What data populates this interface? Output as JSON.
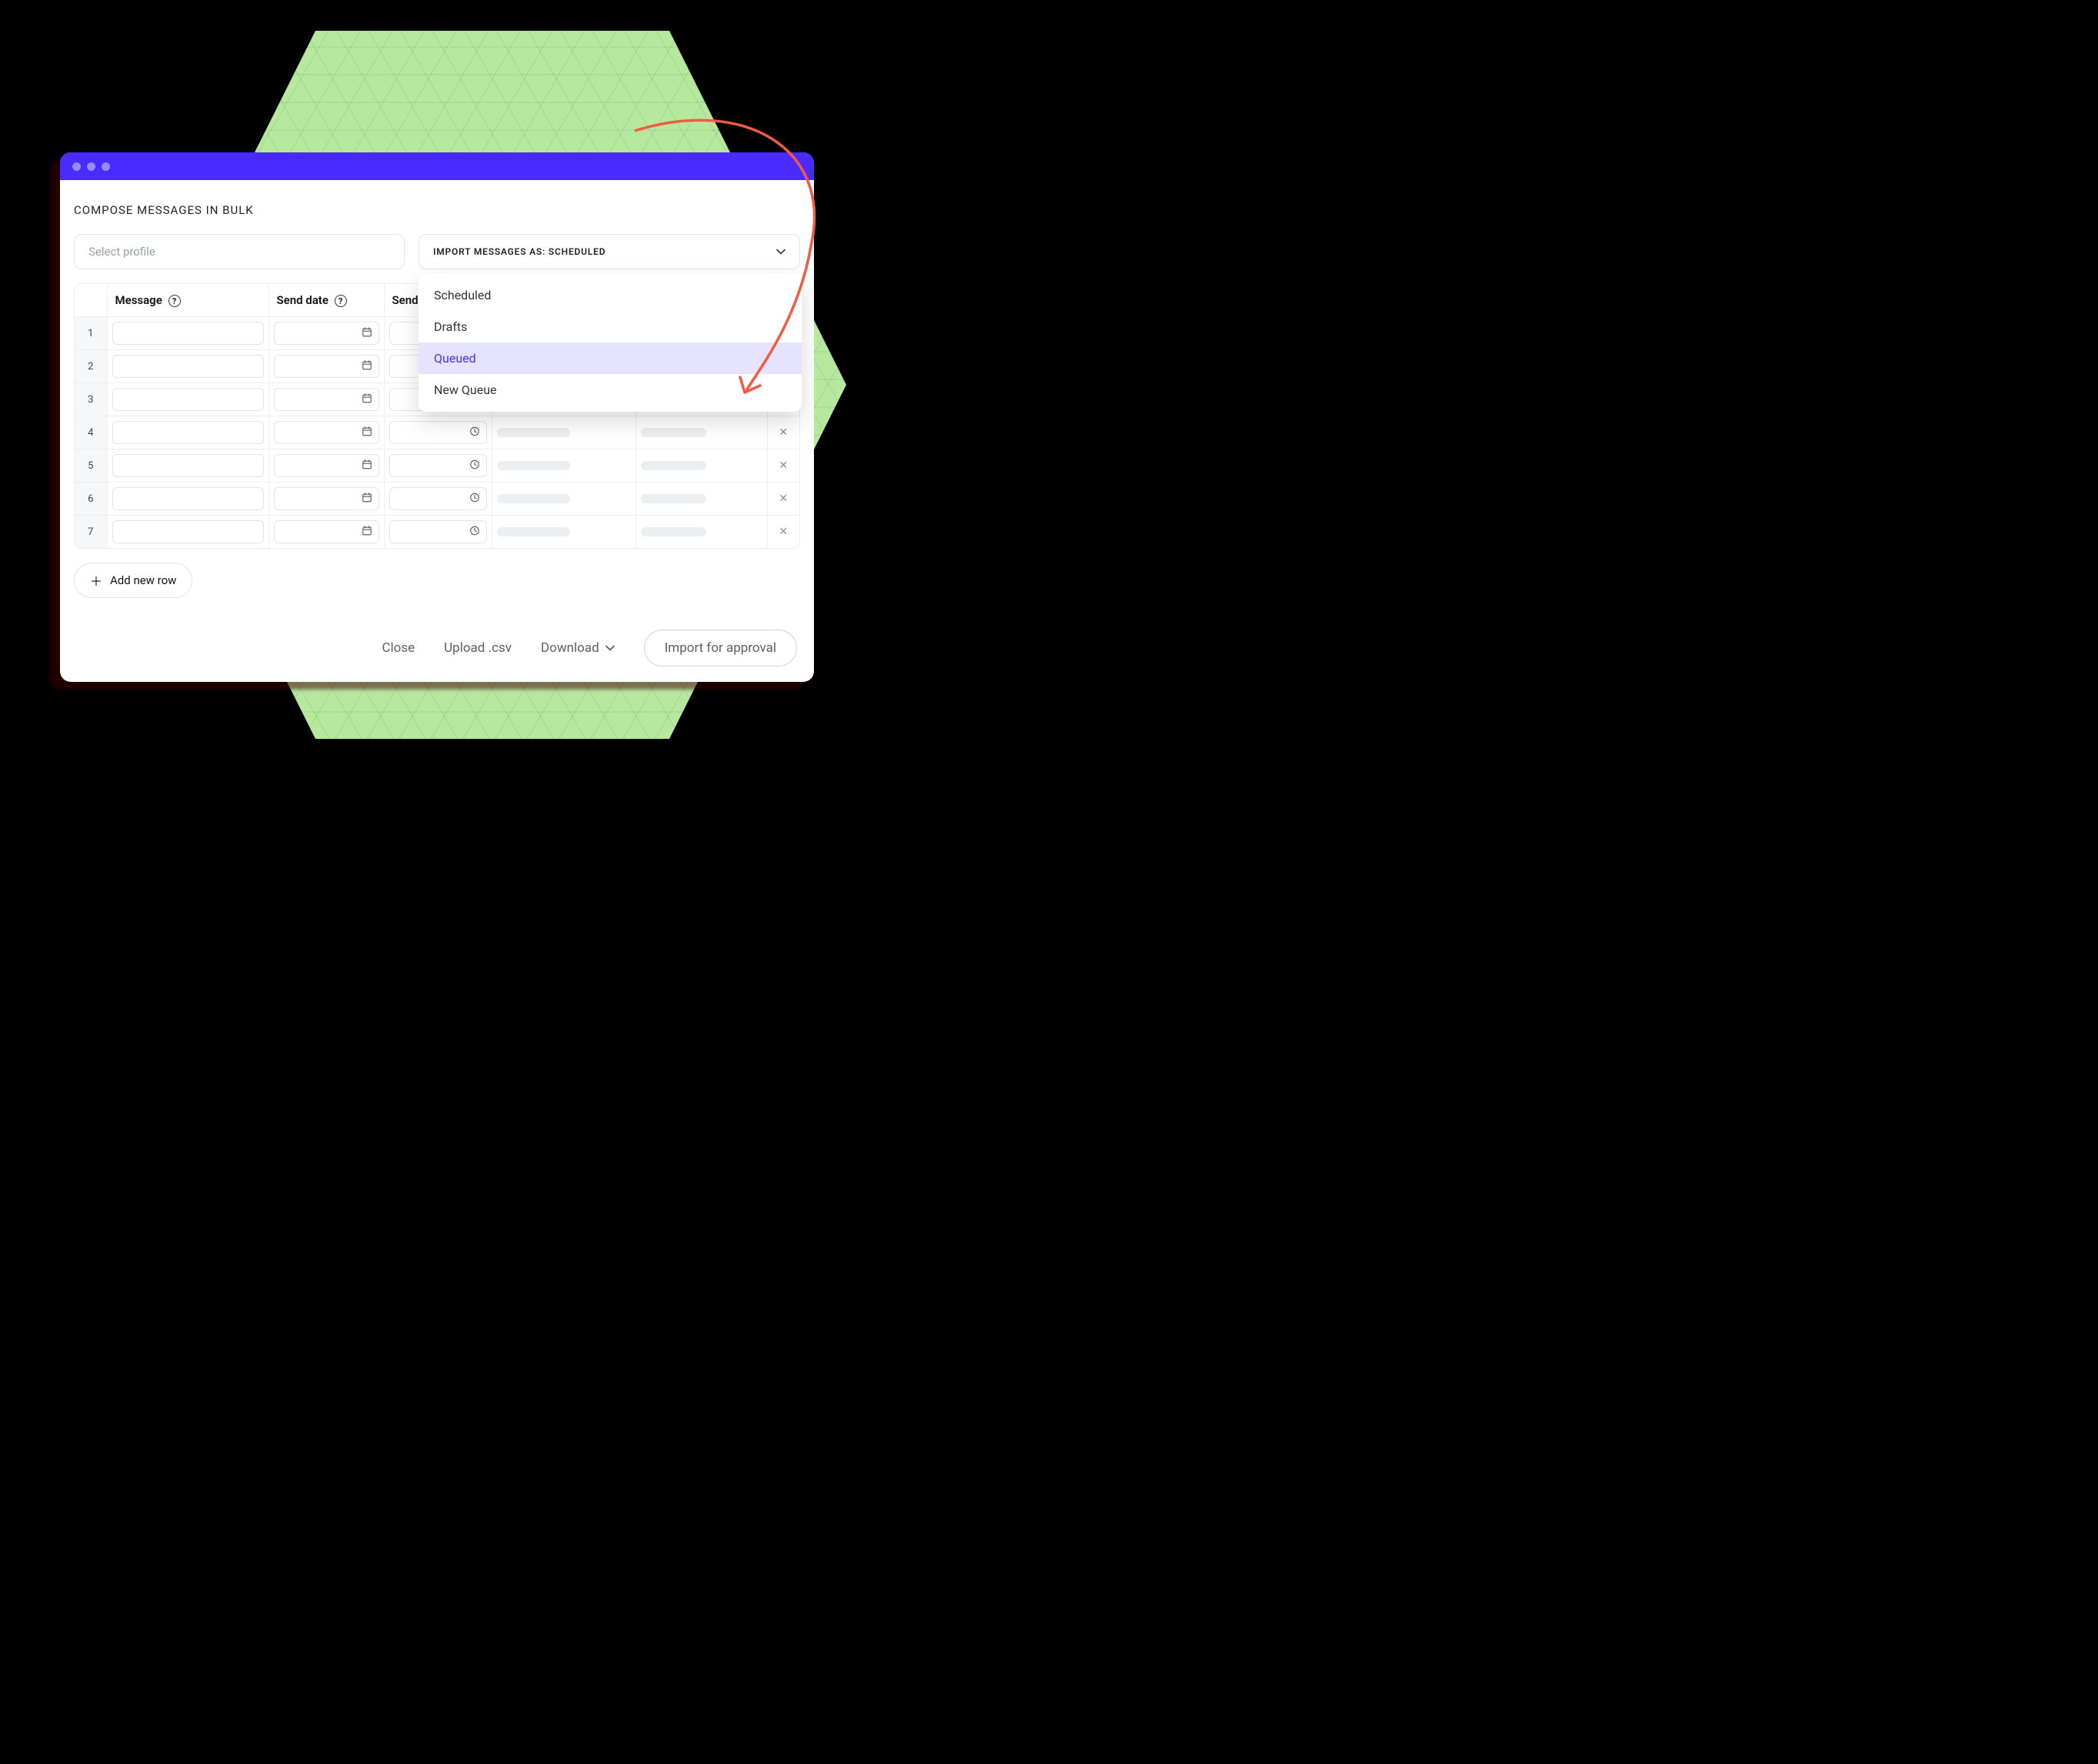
{
  "heading": "COMPOSE MESSAGES IN BULK",
  "profile_placeholder": "Select profile",
  "import_select": {
    "label": "IMPORT MESSAGES AS: SCHEDULED",
    "options": [
      "Scheduled",
      "Drafts",
      "Queued",
      "New Queue"
    ],
    "highlighted": "Queued"
  },
  "columns": {
    "message": "Message",
    "send_date": "Send date",
    "send_time": "Send time"
  },
  "row_numbers": [
    "1",
    "2",
    "3",
    "4",
    "5",
    "6",
    "7"
  ],
  "add_row_label": "Add new row",
  "footer": {
    "close": "Close",
    "upload": "Upload .csv",
    "download": "Download",
    "import": "Import for approval"
  }
}
